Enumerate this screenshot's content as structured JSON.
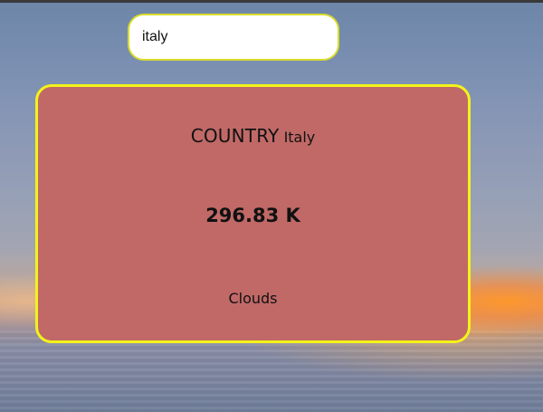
{
  "search": {
    "value": "italy",
    "placeholder": ""
  },
  "weather_card": {
    "country_label": "COUNTRY",
    "country_name": "Italy",
    "temperature": "296.83 K",
    "condition": "Clouds"
  },
  "colors": {
    "card_background": "#c06967",
    "card_border": "#f3f319",
    "search_border": "#d8dc2c"
  }
}
